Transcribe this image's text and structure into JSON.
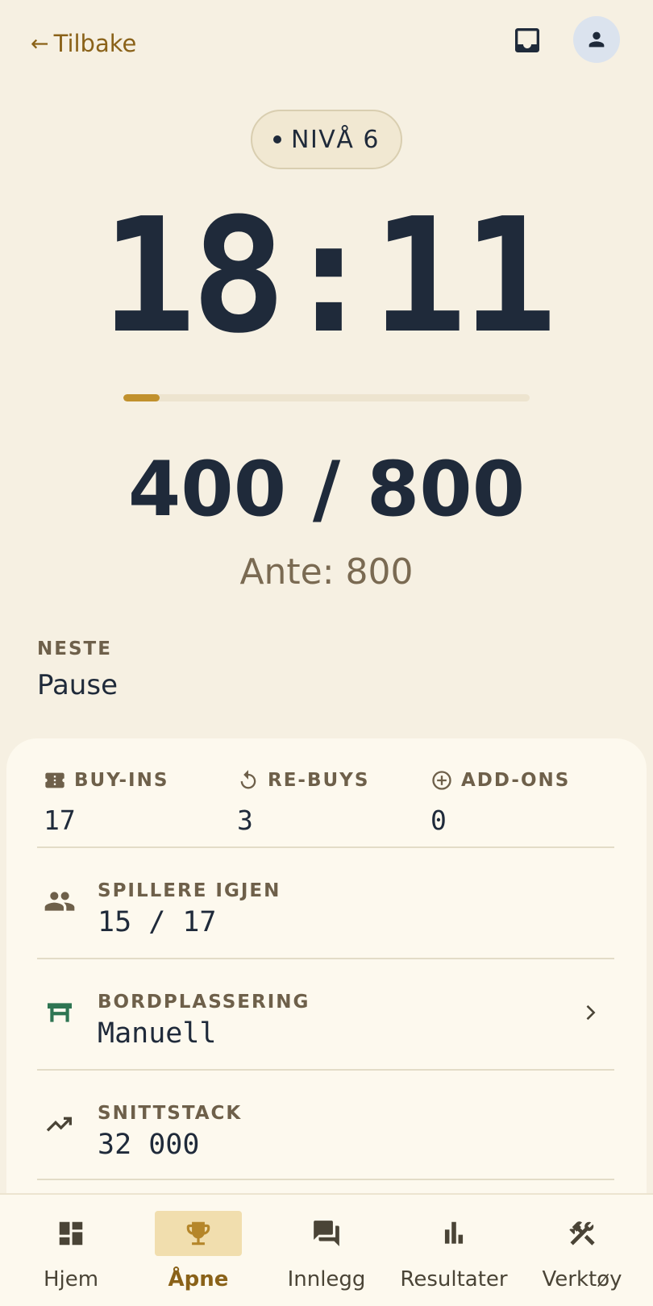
{
  "header": {
    "back_label": "Tilbake",
    "back_icon": "arrow-left-icon",
    "inbox_icon": "inbox-icon",
    "account_icon": "person-icon"
  },
  "level": {
    "label": "NIVÅ 6"
  },
  "timer": {
    "value": "18:11",
    "progress_fraction": 0.09
  },
  "blinds": {
    "value": "400 / 800",
    "ante": "Ante: 800"
  },
  "next": {
    "label": "NESTE",
    "value": "Pause"
  },
  "stats": [
    {
      "icon": "ticket-icon",
      "label": "BUY-INS",
      "value": "17"
    },
    {
      "icon": "rebuy-icon",
      "label": "RE-BUYS",
      "value": "3"
    },
    {
      "icon": "add-circle-icon",
      "label": "ADD-ONS",
      "value": "0"
    }
  ],
  "info": {
    "players": {
      "icon": "group-icon",
      "label": "SPILLERE IGJEN",
      "value": "15 / 17"
    },
    "seating": {
      "icon": "table-icon",
      "label": "BORDPLASSERING",
      "value": "Manuell"
    },
    "stack": {
      "icon": "trending-up-icon",
      "label": "SNITTSTACK",
      "value": "32 000"
    }
  },
  "nav": [
    {
      "label": "Hjem",
      "icon": "dashboard-icon",
      "active": false
    },
    {
      "label": "Åpne",
      "icon": "trophy-icon",
      "active": true
    },
    {
      "label": "Innlegg",
      "icon": "forum-icon",
      "active": false
    },
    {
      "label": "Resultater",
      "icon": "bar-chart-icon",
      "active": false
    },
    {
      "label": "Verktøy",
      "icon": "tools-icon",
      "active": false
    }
  ],
  "colors": {
    "background": "#f6f0e2",
    "card": "#fdf9ee",
    "accent": "#c1912d",
    "brand_text": "#8a6219",
    "table_icon": "#2e7552",
    "dark_text": "#1f2a3a"
  }
}
